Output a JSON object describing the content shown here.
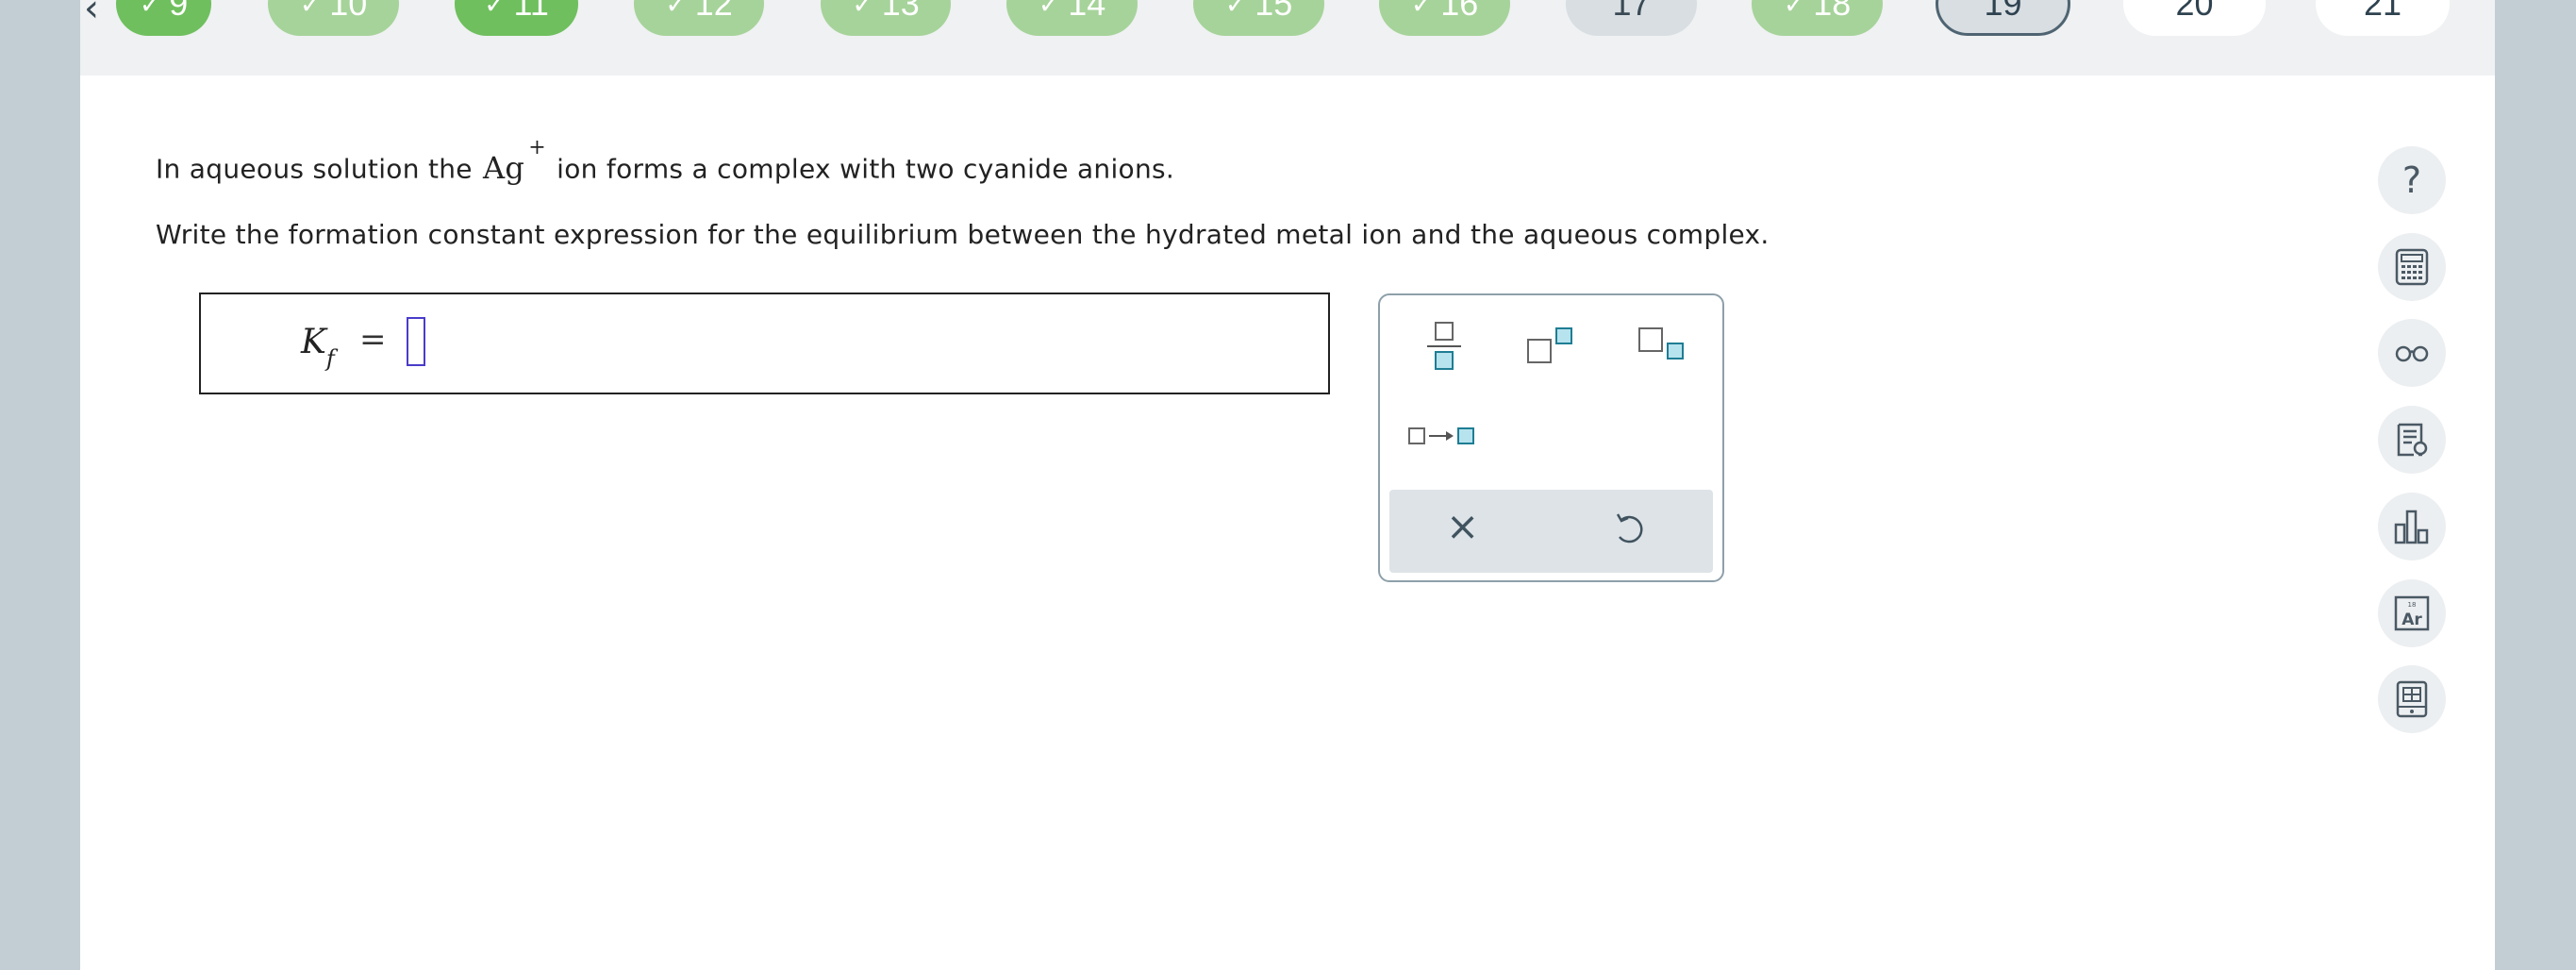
{
  "nav": {
    "back_icon": "chevron-left-icon",
    "questions": [
      {
        "label": "9",
        "status": "correct"
      },
      {
        "label": "10",
        "status": "correct"
      },
      {
        "label": "11",
        "status": "correct-dark"
      },
      {
        "label": "12",
        "status": "correct"
      },
      {
        "label": "13",
        "status": "correct"
      },
      {
        "label": "14",
        "status": "correct"
      },
      {
        "label": "15",
        "status": "correct"
      },
      {
        "label": "16",
        "status": "correct"
      },
      {
        "label": "17",
        "status": "visited"
      },
      {
        "label": "18",
        "status": "correct"
      },
      {
        "label": "19",
        "status": "current"
      },
      {
        "label": "20",
        "status": "unvisited"
      },
      {
        "label": "21",
        "status": "unvisited"
      }
    ],
    "check_glyph": "✓"
  },
  "question": {
    "line1_pre": "In aqueous solution the",
    "ion_symbol": "Ag",
    "ion_charge": "+",
    "line1_post": "ion forms a complex with two cyanide anions.",
    "line2": "Write the formation constant expression for the equilibrium between the hydrated metal ion and the aqueous complex."
  },
  "answer": {
    "lhs_symbol": "K",
    "lhs_subscript": "f",
    "equals": "="
  },
  "palette": {
    "buttons": [
      "fraction-icon",
      "superscript-icon",
      "subscript-icon",
      "reaction-arrow-icon"
    ],
    "clear_glyph": "×",
    "undo_icon": "undo-icon"
  },
  "sidebar": {
    "help_glyph": "?",
    "tools": [
      "help-icon",
      "calculator-icon",
      "glasses-icon",
      "explanation-icon",
      "chart-icon",
      "periodic-table-icon",
      "reference-tablet-icon"
    ]
  },
  "colors": {
    "correct_light": "#a6d39a",
    "correct_dark": "#6fbf5e",
    "template_box": "#b7e3ee",
    "cursor": "#4a3cc9"
  }
}
